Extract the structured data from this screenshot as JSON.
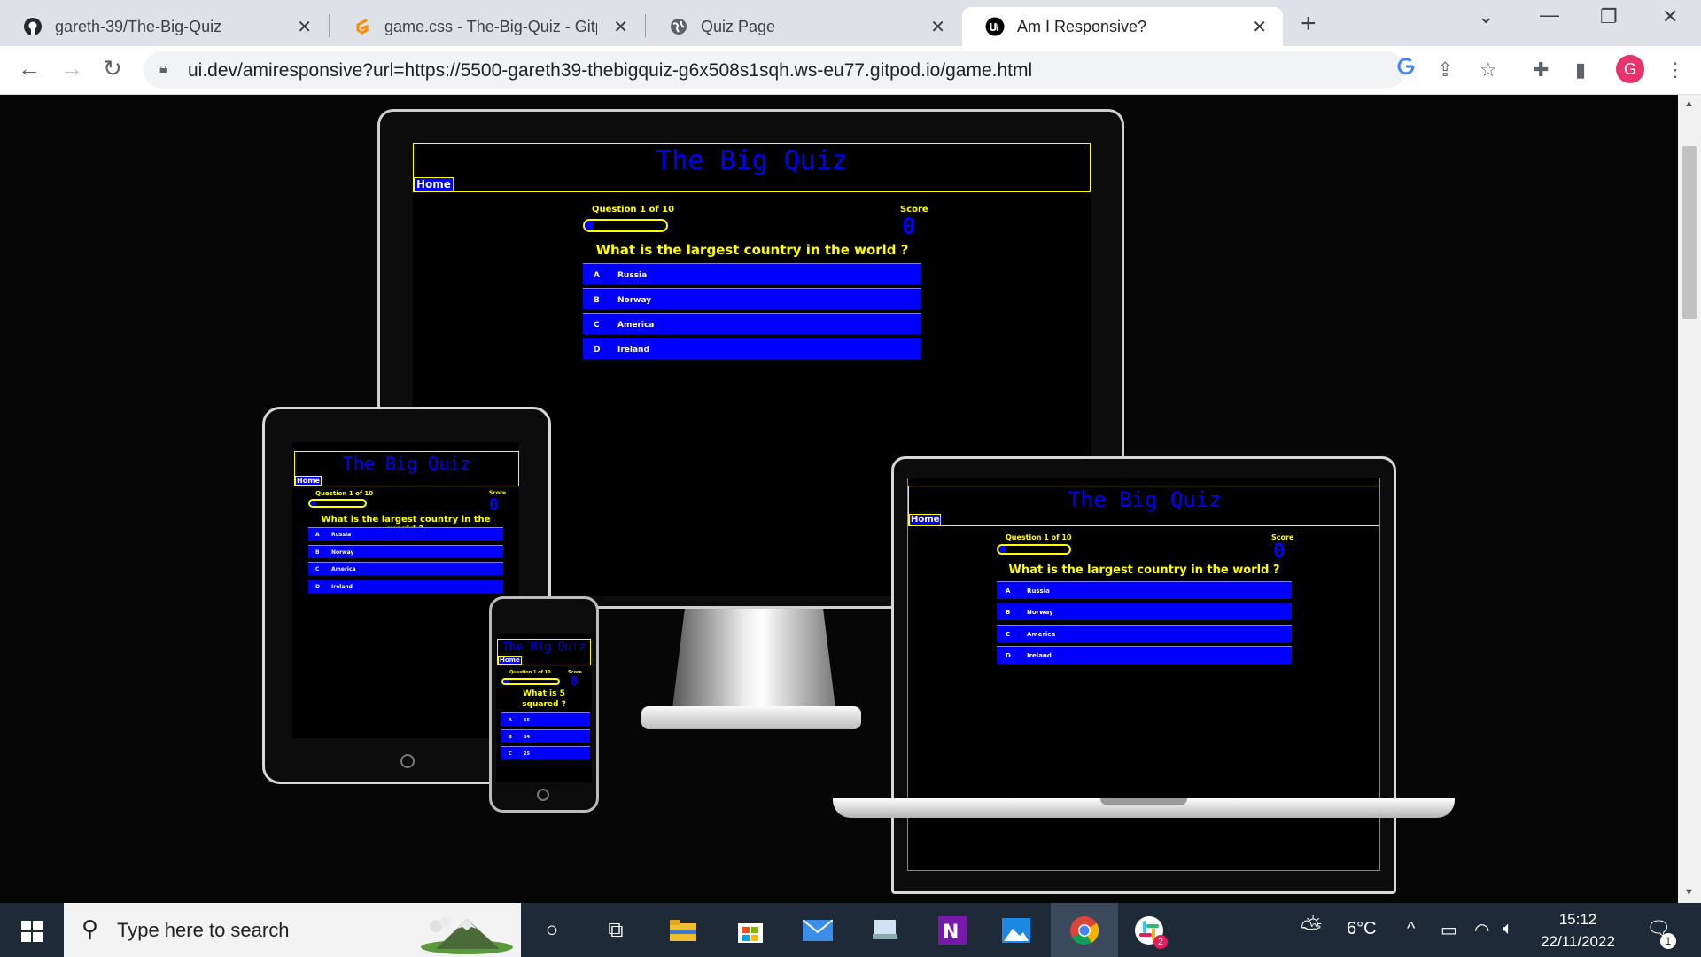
{
  "browser": {
    "tabs": [
      {
        "title": "gareth-39/The-Big-Quiz",
        "icon": "github-icon"
      },
      {
        "title": "game.css - The-Big-Quiz - Gitpod",
        "icon": "gitpod-icon"
      },
      {
        "title": "Quiz Page",
        "icon": "globe-icon"
      },
      {
        "title": "Am I Responsive?",
        "icon": "amiresponsive-icon"
      }
    ],
    "url": "ui.dev/amiresponsive?url=https://5500-gareth39-thebigquiz-g6x508s1sqh.ws-eu77.gitpod.io/game.html",
    "profile_initial": "G"
  },
  "quiz": {
    "title": "The Big Quiz",
    "home": "Home",
    "progress_label": "Question 1 of 10",
    "progress_fraction": 0.1,
    "score_label": "Score",
    "score_value": "0",
    "question": "What is the largest country in the world ?",
    "answers": [
      {
        "prefix": "A",
        "text": "Russia"
      },
      {
        "prefix": "B",
        "text": "Norway"
      },
      {
        "prefix": "C",
        "text": "America"
      },
      {
        "prefix": "D",
        "text": "Ireland"
      }
    ]
  },
  "phone_quiz": {
    "question": "What is 5 squared ?",
    "answers": [
      {
        "prefix": "A",
        "text": "65"
      },
      {
        "prefix": "B",
        "text": "34"
      },
      {
        "prefix": "C",
        "text": "25"
      }
    ]
  },
  "taskbar": {
    "search_placeholder": "Type here to search",
    "weather": "6°C",
    "time": "15:12",
    "date": "22/11/2022",
    "slack_badge": "2",
    "notification_count": "1"
  },
  "colors": {
    "quiz_background": "#000000",
    "quiz_text": "#ffff00",
    "quiz_title": "#0000ff",
    "answer_background": "#0000ff"
  }
}
